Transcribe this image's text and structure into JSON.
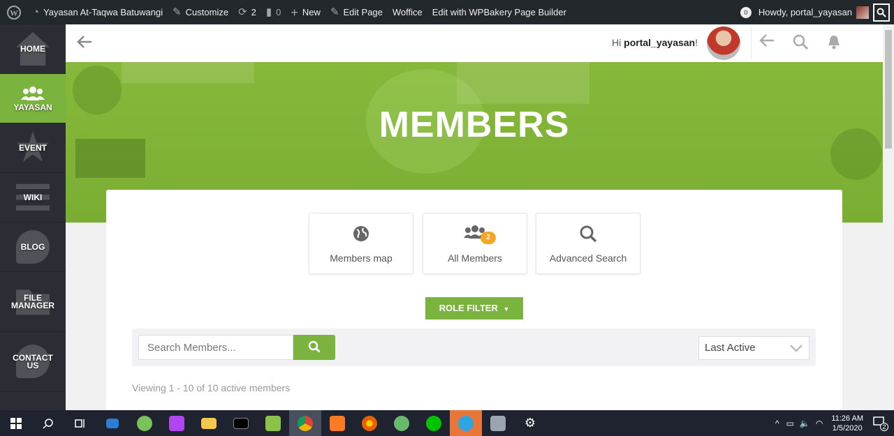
{
  "admin_bar": {
    "site_name": "Yayasan At-Taqwa Batuwangi",
    "customize": "Customize",
    "updates_count": "2",
    "comments_count": "0",
    "new": "New",
    "edit_page": "Edit Page",
    "woffice": "Woffice",
    "wpbakery": "Edit with WPBakery Page Builder",
    "notif_count": "0",
    "howdy": "Howdy, portal_yayasan"
  },
  "sidebar": {
    "items": [
      {
        "label": "HOME",
        "icon": "home-icon"
      },
      {
        "label": "YAYASAN",
        "icon": "users-icon",
        "active": true
      },
      {
        "label": "EVENT",
        "icon": "star-icon"
      },
      {
        "label": "WIKI",
        "icon": "list-icon"
      },
      {
        "label": "BLOG",
        "icon": "chat-icon"
      },
      {
        "label": "FILE MANAGER",
        "icon": "folder-icon"
      },
      {
        "label": "CONTACT US",
        "icon": "chat-icon"
      }
    ]
  },
  "header": {
    "greeting_prefix": "Hi",
    "username": "portal_yayasan",
    "greeting_suffix": "!"
  },
  "hero": {
    "title": "MEMBERS"
  },
  "members": {
    "tabs": [
      {
        "label": "Members map",
        "icon": "globe-icon"
      },
      {
        "label": "All Members",
        "icon": "users-icon",
        "badge": "2"
      },
      {
        "label": "Advanced Search",
        "icon": "search-icon"
      }
    ],
    "role_filter": "ROLE FILTER",
    "search_placeholder": "Search Members...",
    "sort_selected": "Last Active",
    "viewing_text": "Viewing 1 - 10 of 10 active members"
  },
  "taskbar": {
    "time": "11:26 AM",
    "date": "1/5/2020",
    "notification_count": "2"
  },
  "colors": {
    "accent": "#7bb33f",
    "adminbar": "#23282d",
    "sidebar": "#2b2d34",
    "badge": "#f5a623"
  }
}
